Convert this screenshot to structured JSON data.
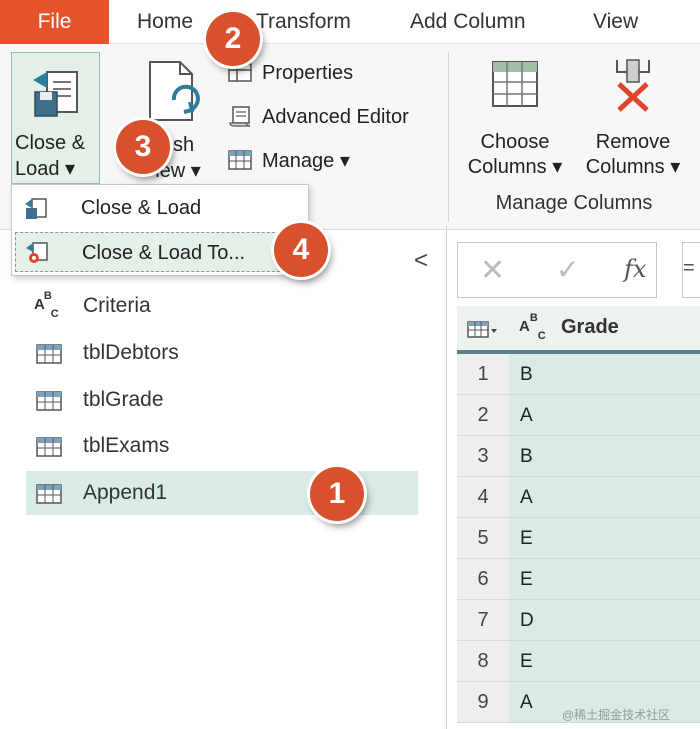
{
  "tabs": {
    "file": "File",
    "home": "Home",
    "transform": "Transform",
    "add_column": "Add Column",
    "view": "View"
  },
  "ribbon": {
    "close_load": {
      "line1": "Close &",
      "line2": "Load ▾"
    },
    "refresh_preview": {
      "line1": "esh",
      "line2": "iew ▾"
    },
    "properties": "Properties",
    "advanced_editor": "Advanced Editor",
    "manage": "Manage ▾",
    "choose_columns": {
      "line1": "Choose",
      "line2": "Columns ▾"
    },
    "remove_columns": {
      "line1": "Remove",
      "line2": "Columns ▾"
    },
    "group_manage_columns": "Manage Columns"
  },
  "dropdown": {
    "close_load": "Close & Load",
    "close_load_to": "Close & Load To..."
  },
  "queries": [
    {
      "name": "Criteria",
      "icon": "abc-text-icon"
    },
    {
      "name": "tblDebtors",
      "icon": "table-icon"
    },
    {
      "name": "tblGrade",
      "icon": "table-icon"
    },
    {
      "name": "tblExams",
      "icon": "table-icon"
    },
    {
      "name": "Append1",
      "icon": "table-icon",
      "selected": true
    }
  ],
  "formula_bar": {
    "fx": "fx",
    "equals": "="
  },
  "grid": {
    "column": "Grade",
    "rows": [
      {
        "n": "1",
        "v": "B"
      },
      {
        "n": "2",
        "v": "A"
      },
      {
        "n": "3",
        "v": "B"
      },
      {
        "n": "4",
        "v": "A"
      },
      {
        "n": "5",
        "v": "E"
      },
      {
        "n": "6",
        "v": "E"
      },
      {
        "n": "7",
        "v": "D"
      },
      {
        "n": "8",
        "v": "E"
      },
      {
        "n": "9",
        "v": "A"
      }
    ]
  },
  "badges": {
    "b1": "1",
    "b2": "2",
    "b3": "3",
    "b4": "4"
  },
  "collapse_glyph": "<",
  "watermark": "@稀土掘金技术社区",
  "colors": {
    "file_tab": "#e5532d",
    "badge": "#d9512c",
    "selection": "#d9ebe2",
    "column_underline": "#5e7f93"
  }
}
